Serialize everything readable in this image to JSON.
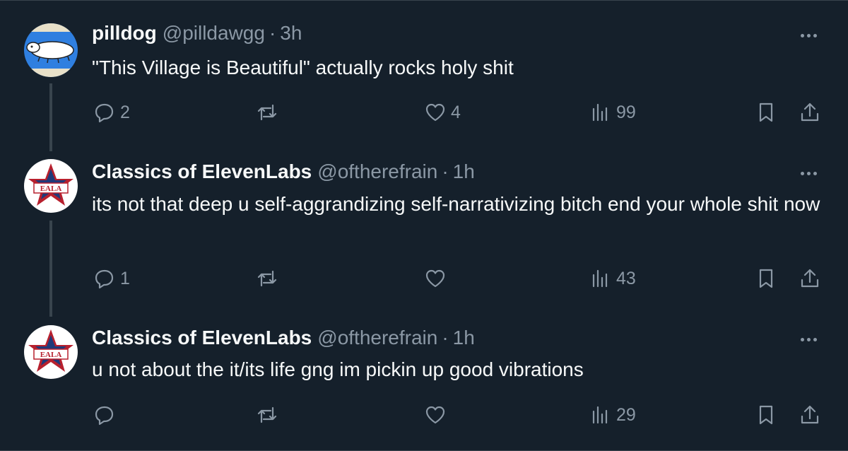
{
  "tweets": [
    {
      "name": "pilldog",
      "handle": "@pilldawgg",
      "separator": "·",
      "time": "3h",
      "text": "\"This Village is Beautiful\" actually rocks holy shit",
      "replies": "2",
      "retweets": "",
      "likes": "4",
      "views": "99",
      "avatar_icon": "white-dog-on-blue-avatar"
    },
    {
      "name": "Classics of ElevenLabs",
      "handle": "@oftherefrain",
      "separator": "·",
      "time": "1h",
      "text": "its not that deep u self-aggrandizing self-narrativizing bitch end your whole shit now",
      "replies": "1",
      "retweets": "",
      "likes": "",
      "views": "43",
      "avatar_icon": "star-logo-avatar"
    },
    {
      "name": "Classics of ElevenLabs",
      "handle": "@oftherefrain",
      "separator": "·",
      "time": "1h",
      "text": "u not about the it/its life gng im pickin up good vibrations",
      "replies": "",
      "retweets": "",
      "likes": "",
      "views": "29",
      "avatar_icon": "star-logo-avatar"
    }
  ],
  "colors": {
    "background": "#15202b",
    "text": "#f7f9f9",
    "secondary": "#8b98a5",
    "thread_line": "#38444d"
  }
}
